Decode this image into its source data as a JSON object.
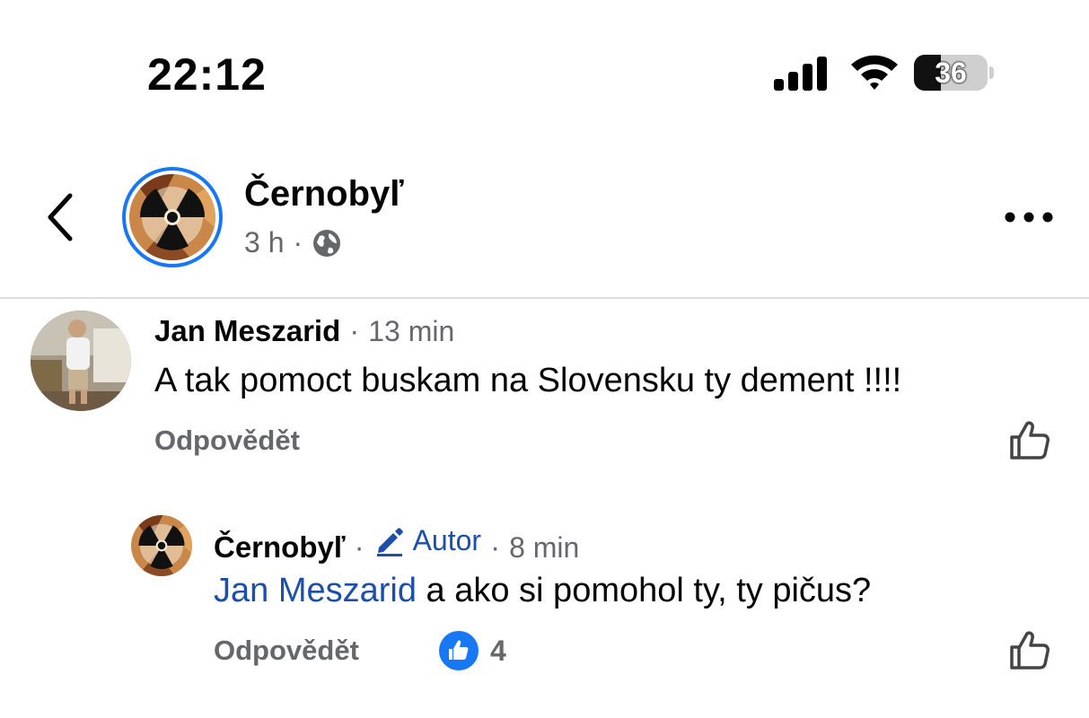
{
  "status_bar": {
    "time": "22:12",
    "battery_level": "36",
    "battery_fraction": 0.36
  },
  "header": {
    "page_name": "Černobyľ",
    "post_age": "3 h",
    "separator": "·",
    "audience_icon": "globe-icon",
    "back_icon": "chevron-left-icon",
    "more_icon": "more-horizontal-icon"
  },
  "comments": [
    {
      "author": "Jan Meszarid",
      "separator": "·",
      "time": "13 min",
      "text": "A tak pomoct buskam na Slovensku ty dement !!!!",
      "reply_label": "Odpovědět",
      "like_icon": "thumbs-up-icon"
    },
    {
      "author": "Černobyľ",
      "separator": "·",
      "badge": "Autor",
      "badge_separator": "·",
      "time": "8 min",
      "mention": "Jan Meszarid",
      "text": " a ako si pomohol ty, ty pičus?",
      "reply_label": "Odpovědět",
      "reaction_count": "4",
      "reaction_icon": "like-reaction-icon",
      "like_icon": "thumbs-up-icon"
    }
  ],
  "colors": {
    "accent": "#1877f2",
    "mention": "#1b4fa8",
    "secondary_text": "#65676b"
  }
}
